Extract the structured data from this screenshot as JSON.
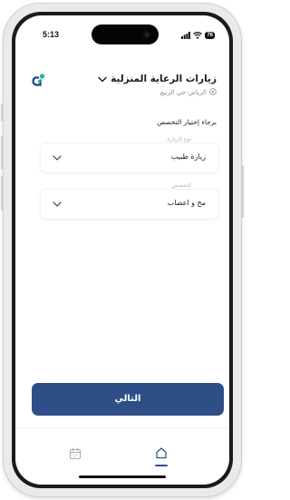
{
  "status_bar": {
    "time": "5:13",
    "battery": "76"
  },
  "header": {
    "title": "زيارات الرعاية المنزلية",
    "location": "الرياض-حي الربيع",
    "icons": [
      "chevron-down-icon",
      "location-pin-icon",
      "app-logo"
    ]
  },
  "form": {
    "prompt": "برجاء إختيار التخصص",
    "visit_type": {
      "label": "نوع الزيارة",
      "value": "زيارة طبيب"
    },
    "specialty": {
      "label": "التخصص",
      "value": "مخ و اعصاب"
    }
  },
  "actions": {
    "next_label": "التالي"
  },
  "bottom_nav": {
    "items": [
      {
        "icon": "calendar-icon",
        "active": false
      },
      {
        "icon": "home-icon",
        "active": true
      }
    ]
  },
  "colors": {
    "primary": "#2d4e86",
    "logo_teal": "#1fb8a6",
    "logo_blue": "#2d4e86",
    "muted_text": "#8d8f96"
  }
}
